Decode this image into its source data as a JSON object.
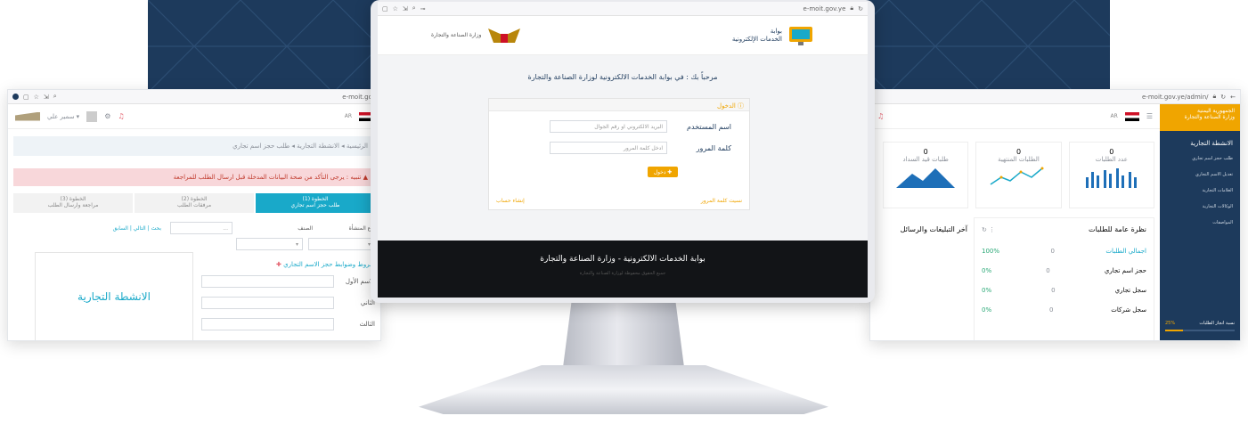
{
  "center": {
    "url": "e-moit.gov.ye",
    "logo_text_line1": "بوابة",
    "logo_text_line2": "الخدمات الإلكترونية",
    "ministry_text": "وزارة الصناعة والتجارة",
    "welcome": "مرحباً بك : في بوابة الخدمات الالكترونية لوزارة الصناعة والتجارة",
    "form_header": "الدخول",
    "username_label": "اسم المستخدم",
    "username_placeholder": "البريد الالكتروني او رقم الجوال",
    "password_label": "كلمة المرور",
    "password_placeholder": "ادخل كلمة المرور",
    "login_button": "دخول",
    "forgot": "نسيت كلمة المرور",
    "create": "إنشاء حساب",
    "footer_title": "بوابة الخدمات الالكترونية - وزارة الصناعة والتجارة",
    "footer_sub": "جميع الحقوق محفوظة لوزارة الصناعة والتجارة"
  },
  "left": {
    "url": "e-moit.gov",
    "username": "سمير علي",
    "breadcrumb": "الرئيسية ◂ الانشطة التجارية ◂ طلب حجز اسم تجاري",
    "alert": "تنبيه : يرجى التأكد من صحة البيانات المدخلة قبل ارسال الطلب للمراجعة",
    "step1": "الخطوة (1)",
    "step1_sub": "طلب حجز اسم تجاري",
    "step2": "الخطوة (2)",
    "step2_sub": "مرفقات الطلب",
    "step3": "الخطوة (3)",
    "step3_sub": "مراجعة وارسال الطلب",
    "col_type": "نوع المنشأة",
    "col_class": "الصنف",
    "nav": "بحث | التالي | السابق",
    "note": "شروط وضوابط حجز الاسم التجاري",
    "first_name": "الاسم الأول",
    "second_name": "الثاني",
    "third_name": "الثالث",
    "big_label": "الانشطة التجارية"
  },
  "right": {
    "url": "e-moit.gov.ye/admin/",
    "org_line1": "الجمهورية اليمنية",
    "org_line2": "وزارة الصناعة والتجارة",
    "side_items": [
      "الانشطة التجارية",
      "طلب حجز اسم تجاري",
      "تعديل الاسم التجاري",
      "العلامات التجارية",
      "الوكالات التجارية",
      "المواصفات"
    ],
    "progress_pct": "25%",
    "progress_label": "نسبة انجاز الطلبات",
    "stats": [
      {
        "value": "0",
        "label": "عدد الطلبات"
      },
      {
        "value": "0",
        "label": "الطلبات المنتهية"
      },
      {
        "value": "0",
        "label": "طلبات قيد السداد"
      }
    ],
    "summary_title": "نظرة عامة للطلبات",
    "messages_title": "آخر التبليغات والرسائل",
    "summary_rows": [
      {
        "label": "اجمالي الطلبات",
        "count": "0",
        "pct": "100%"
      },
      {
        "label": "حجز اسم تجاري",
        "count": "0",
        "pct": "0%"
      },
      {
        "label": "سجل تجاري",
        "count": "0",
        "pct": "0%"
      },
      {
        "label": "سجل شركات",
        "count": "0",
        "pct": "0%"
      }
    ]
  },
  "colors": {
    "accent": "#f0a500",
    "teal": "#19a9c9",
    "navy": "#1d3a5c",
    "alert": "#f8d7da"
  }
}
